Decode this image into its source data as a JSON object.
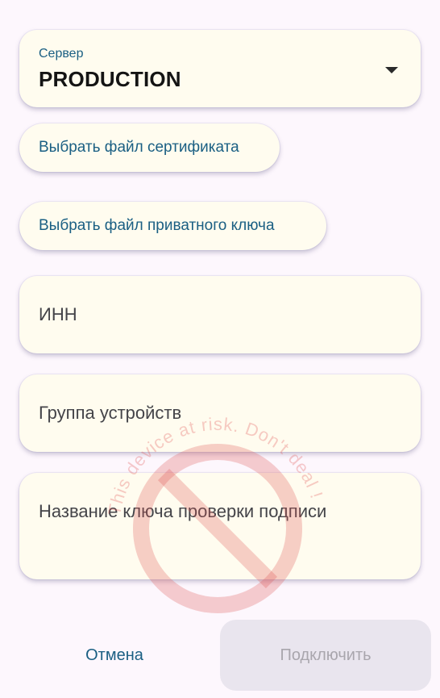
{
  "server": {
    "label": "Сервер",
    "value": "PRODUCTION"
  },
  "buttons": {
    "select_certificate": "Выбрать файл сертификата",
    "select_private_key": "Выбрать файл приватного ключа",
    "cancel": "Отмена",
    "connect": "Подключить"
  },
  "fields": {
    "inn": "ИНН",
    "device_group": "Группа устройств",
    "signature_key_name": "Название ключа проверки подписи"
  },
  "watermark": {
    "text": "This device at risk. Don't deal !"
  },
  "colors": {
    "accent": "#1a5f83",
    "card_background": "#fffcef",
    "page_background": "#fdf7fd",
    "disabled_button": "#e9e5ee",
    "watermark": "#e05555"
  }
}
